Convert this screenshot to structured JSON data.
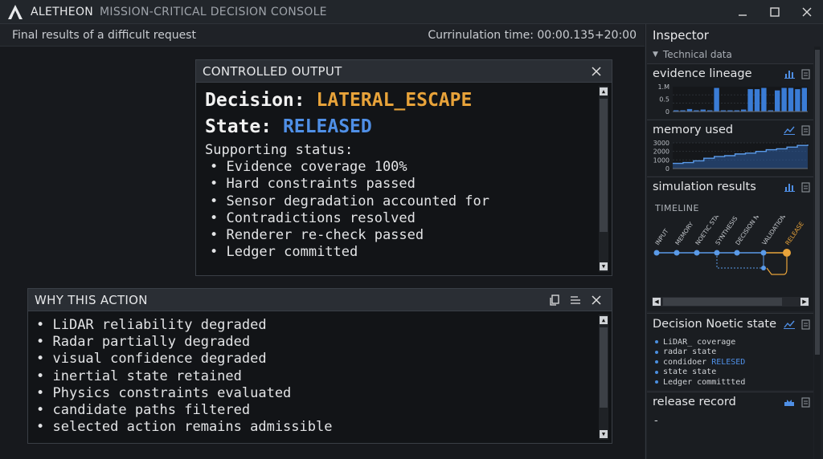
{
  "window": {
    "app_name": "ALETHEON",
    "app_subtitle": "MISSION-CRITICAL DECISION CONSOLE"
  },
  "status": {
    "left": "Final results of a difficult request",
    "right": "Currinulation time: 00:00.135+20:00"
  },
  "controlled_output": {
    "title": "CONTROLLED OUTPUT",
    "decision_label": "Decision:",
    "decision_value": "LATERAL_ESCAPE",
    "state_label": "State:",
    "state_value": "RELEASED",
    "supporting_title": "Supporting status:",
    "items": [
      "Evidence coverage 100%",
      "Hard constraints passed",
      "Sensor degradation accounted for",
      "Contradictions resolved",
      "Renderer re-check passed",
      "Ledger committed"
    ]
  },
  "why": {
    "title": "WHY THIS ACTION",
    "items": [
      "LiDAR reliability degraded",
      "Radar partially degraded",
      "visual confidence degraded",
      "inertial state retained",
      "Physics constraints evaluated",
      "candidate paths filtered",
      "selected action remains admissible"
    ]
  },
  "inspector": {
    "title": "Inspector",
    "technical": "Technical data",
    "evidence": {
      "title": "evidence lineage",
      "ticks": [
        "1.M",
        "0.5",
        "0"
      ],
      "bars": [
        0.05,
        0.05,
        0.1,
        0.05,
        0.08,
        0.05,
        0.95,
        0.05,
        0.05,
        0.05,
        0.08,
        0.9,
        0.9,
        0.95,
        0.05,
        0.85,
        0.95,
        0.95,
        0.9,
        0.95
      ]
    },
    "memory": {
      "title": "memory used",
      "ticks": [
        "3000",
        "2000",
        "1000",
        "0"
      ],
      "values": [
        600,
        700,
        900,
        1200,
        1400,
        1500,
        1700,
        1800,
        2000,
        2200,
        2300,
        2500,
        2700,
        2800
      ]
    },
    "simulation": {
      "title": "simulation results",
      "timeline_label": "TIMELINE",
      "steps": [
        "INPUT",
        "MEMORY",
        "NOETIC STATE",
        "SYNTHESIS",
        "DECISION NOETIC",
        "VALIDATION",
        "RELEASE"
      ]
    },
    "noetic": {
      "title": "Decision Noetic state",
      "items": [
        {
          "text": "LiDAR_ coverage",
          "highlight": ""
        },
        {
          "text": "radar state",
          "highlight": ""
        },
        {
          "text": "condidoer",
          "highlight": "RELESED"
        },
        {
          "text": "state state",
          "highlight": ""
        },
        {
          "text": "Ledger committted",
          "highlight": ""
        }
      ]
    },
    "release": {
      "title": "release record",
      "value": "-"
    }
  },
  "colors": {
    "orange": "#e8a33a",
    "blue": "#4f8fe6",
    "bar": "#3a7cd6"
  }
}
